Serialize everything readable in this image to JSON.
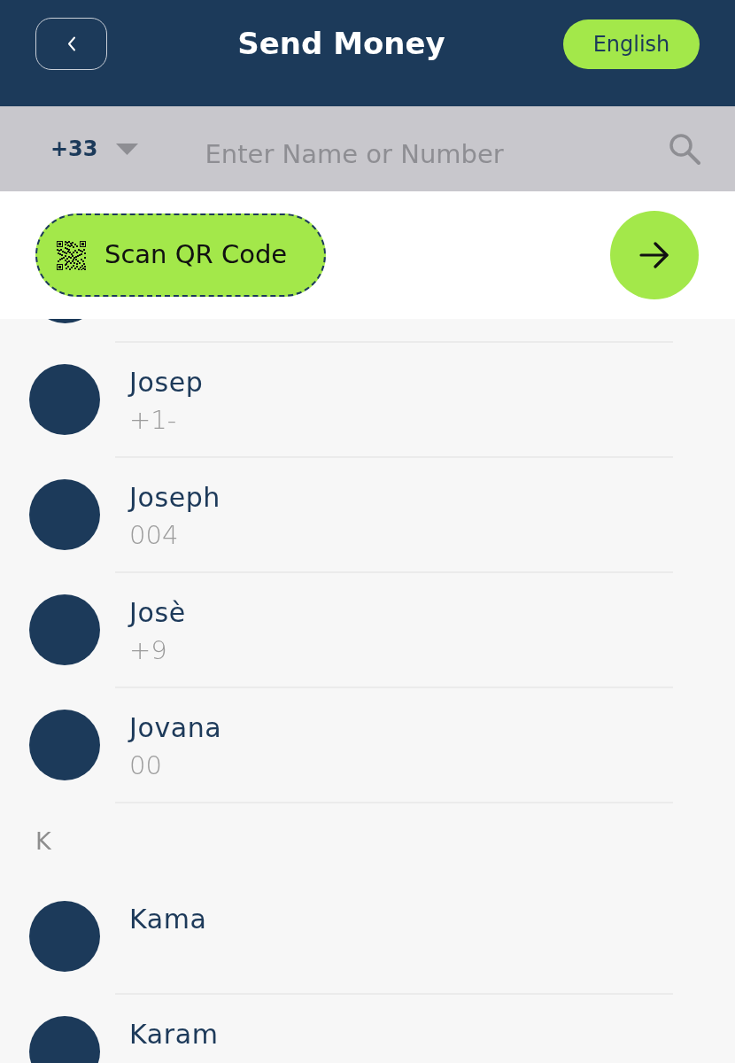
{
  "header": {
    "title": "Send Money",
    "language_button": "English"
  },
  "search": {
    "country_code": "+33",
    "placeholder": "Enter Name or Number"
  },
  "scan_button": {
    "label": "Scan QR Code"
  },
  "contacts": [
    {
      "kind": "contact",
      "name": "Josep",
      "number": "+1-"
    },
    {
      "kind": "contact",
      "name": "Joseph",
      "number": "004"
    },
    {
      "kind": "contact",
      "name": "Josè",
      "number": "+9"
    },
    {
      "kind": "contact",
      "name": "Jovana",
      "number": "00"
    },
    {
      "kind": "section",
      "letter": "K"
    },
    {
      "kind": "contact",
      "name": "Kama"
    },
    {
      "kind": "contact",
      "name": "Karam"
    }
  ]
}
